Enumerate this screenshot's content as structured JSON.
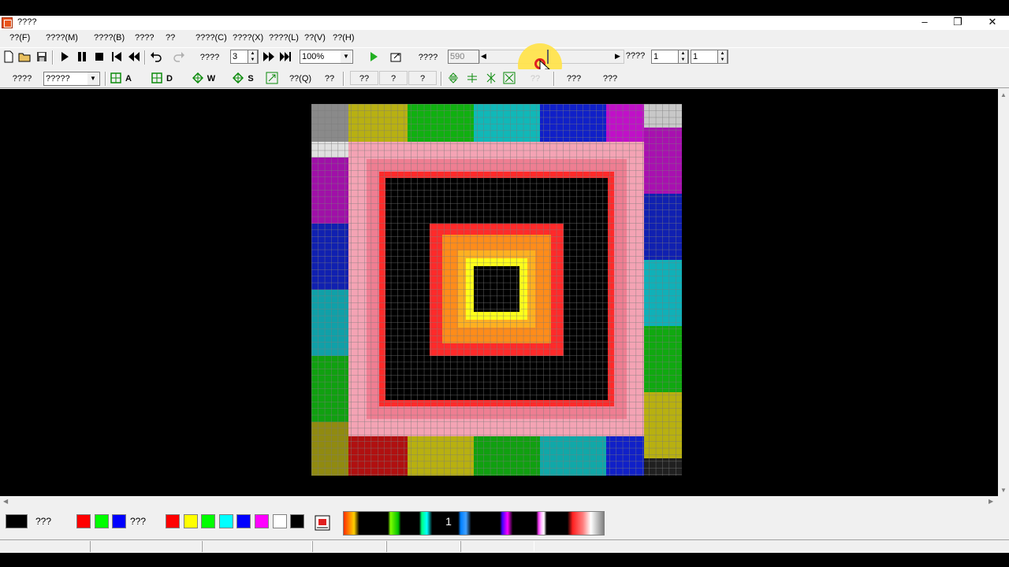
{
  "window": {
    "title": "????",
    "controls": {
      "minimize": "–",
      "maximize": "❐",
      "close": "✕"
    }
  },
  "menu": [
    "??(F)",
    "????(M)",
    "????(B)",
    "????",
    "??",
    "????(C)",
    "????(X)",
    "????(L)",
    "??(V)",
    "??(H)"
  ],
  "toolbar1": {
    "label_a": "????",
    "frame_value": "3",
    "zoom_value": "100%",
    "label_b": "????",
    "frame_total": "590",
    "label_c": "????",
    "spin1_value": "1",
    "spin2_value": "1"
  },
  "toolbar2": {
    "label_a": "????",
    "combo_value": "?????",
    "btn_a": "A",
    "btn_d": "D",
    "btn_w": "W",
    "btn_s": "S",
    "btn_q": "??(Q)",
    "btn_q2": "??",
    "btn_b1": "??",
    "btn_b2": "?",
    "btn_b3": "?",
    "btn_faded": "??",
    "btn_c1": "???",
    "btn_c2": "???"
  },
  "palette": {
    "label_black": "???",
    "label_rgb": "???",
    "gradient_marker": "1"
  },
  "colors": {
    "pink": "#f4a3b4",
    "red": "#ff2a2a",
    "orange": "#ff8c1a",
    "yellow": "#ffff1a",
    "grid_line": "#7a7a7a"
  }
}
